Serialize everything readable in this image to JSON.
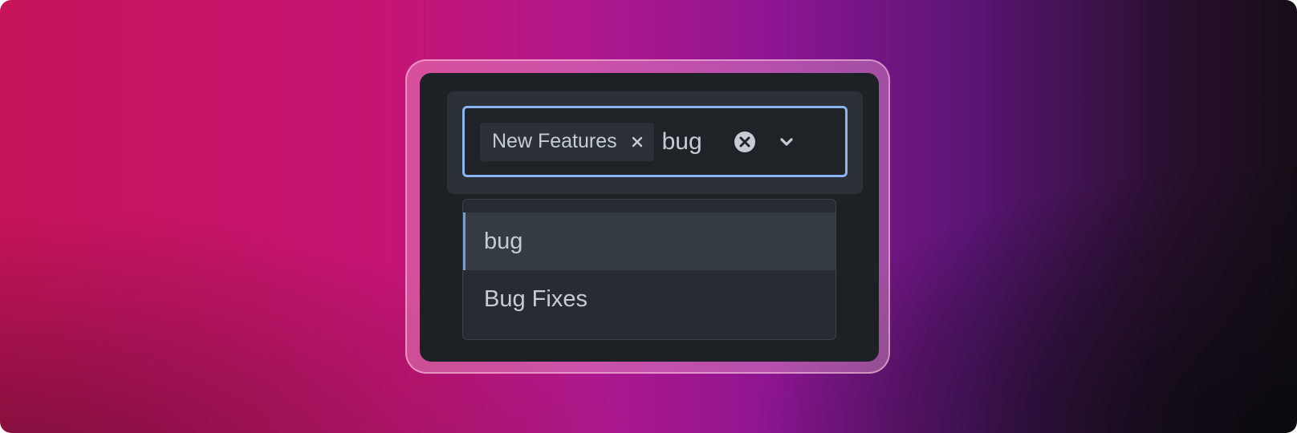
{
  "select": {
    "tags": [
      {
        "label": "New Features"
      }
    ],
    "input_value": "bug",
    "menu_open": true
  },
  "menu": {
    "options": [
      {
        "label": "bug",
        "active": true
      },
      {
        "label": "Bug Fixes",
        "active": false
      }
    ]
  },
  "colors": {
    "focus_ring": "#8ab4f3",
    "active_indicator": "#6f9ee8",
    "panel_bg": "#1d2024",
    "control_bg": "#1f2226",
    "tag_bg": "#2c3138",
    "menu_bg": "#282c32",
    "active_option_bg": "#343b43",
    "text": "#c6ccd3"
  },
  "icons": {
    "tag_remove": "close-icon",
    "clear": "clear-circle-icon",
    "dropdown": "chevron-down-icon"
  }
}
